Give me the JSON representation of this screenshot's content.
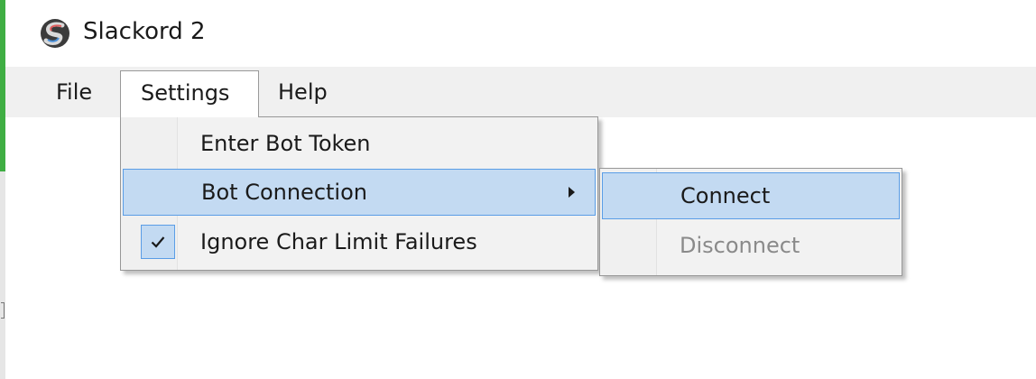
{
  "window": {
    "title": "Slackord 2",
    "icon": "slackord-logo-icon"
  },
  "menu_bar": {
    "items": [
      {
        "label": "File"
      },
      {
        "label": "Settings"
      },
      {
        "label": "Help"
      }
    ]
  },
  "settings_menu": {
    "items": [
      {
        "label": "Enter Bot Token"
      },
      {
        "label": "Bot Connection",
        "has_submenu": true,
        "highlighted": true
      },
      {
        "label": "Ignore Char Limit Failures",
        "checked": true
      }
    ]
  },
  "bot_connection_submenu": {
    "items": [
      {
        "label": "Connect",
        "highlighted": true,
        "enabled": true
      },
      {
        "label": "Disconnect",
        "enabled": false
      }
    ]
  },
  "colors": {
    "highlight_bg": "#c3daf2",
    "highlight_border": "#5a9de6",
    "menu_bg": "#f0f0f0",
    "disabled_text": "#8a8a8a"
  }
}
